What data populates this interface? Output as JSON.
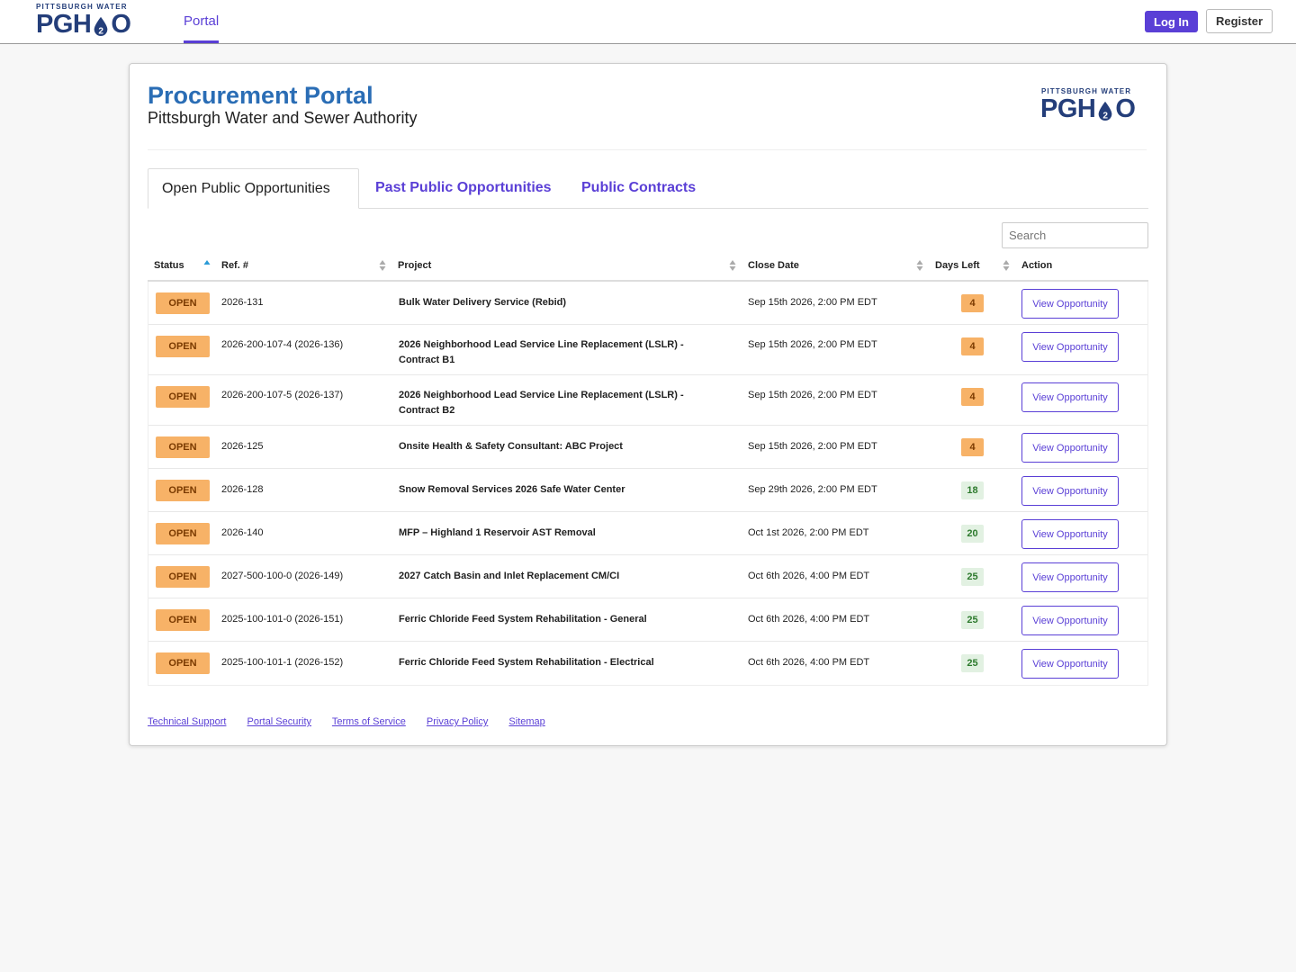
{
  "header": {
    "logo_top": "PITTSBURGH WATER",
    "logo_left": "PGH",
    "logo_sub": "2",
    "logo_right": "O",
    "nav_portal": "Portal",
    "login_label": "Log In",
    "register_label": "Register",
    "accent_color": "#5a3fd6"
  },
  "page": {
    "title": "Procurement Portal",
    "subtitle": "Pittsburgh Water and Sewer Authority"
  },
  "tabs": [
    {
      "label": "Open Public Opportunities",
      "active": true
    },
    {
      "label": "Past Public Opportunities",
      "active": false
    },
    {
      "label": "Public Contracts",
      "active": false
    }
  ],
  "search": {
    "placeholder": "Search"
  },
  "table": {
    "headers": {
      "status": "Status",
      "ref": "Ref. #",
      "project": "Project",
      "close_date": "Close Date",
      "days_left": "Days Left",
      "action": "Action"
    },
    "action_label": "View Opportunity",
    "rows": [
      {
        "status": "OPEN",
        "ref": "2026-131",
        "project": "Bulk Water Delivery Service (Rebid)",
        "close": "Sep 15th 2026, 2:00 PM EDT",
        "days": "4"
      },
      {
        "status": "OPEN",
        "ref": "2026-200-107-4 (2026-136)",
        "project": "2026 Neighborhood Lead Service Line Replacement (LSLR) - Contract B1",
        "close": "Sep 15th 2026, 2:00 PM EDT",
        "days": "4"
      },
      {
        "status": "OPEN",
        "ref": "2026-200-107-5 (2026-137)",
        "project": "2026 Neighborhood Lead Service Line Replacement (LSLR) - Contract B2",
        "close": "Sep 15th 2026, 2:00 PM EDT",
        "days": "4"
      },
      {
        "status": "OPEN",
        "ref": "2026-125",
        "project": "Onsite Health & Safety Consultant: ABC Project",
        "close": "Sep 15th 2026, 2:00 PM EDT",
        "days": "4"
      },
      {
        "status": "OPEN",
        "ref": "2026-128",
        "project": "Snow Removal Services 2026 Safe Water Center",
        "close": "Sep 29th 2026, 2:00 PM EDT",
        "days": "18"
      },
      {
        "status": "OPEN",
        "ref": "2026-140",
        "project": "MFP – Highland 1 Reservoir AST Removal",
        "close": "Oct 1st 2026, 2:00 PM EDT",
        "days": "20"
      },
      {
        "status": "OPEN",
        "ref": "2027-500-100-0 (2026-149)",
        "project": "2027 Catch Basin and Inlet Replacement CM/CI",
        "close": "Oct 6th 2026, 4:00 PM EDT",
        "days": "25"
      },
      {
        "status": "OPEN",
        "ref": "2025-100-101-0 (2026-151)",
        "project": "Ferric Chloride Feed System Rehabilitation - General",
        "close": "Oct 6th 2026, 4:00 PM EDT",
        "days": "25"
      },
      {
        "status": "OPEN",
        "ref": "2025-100-101-1 (2026-152)",
        "project": "Ferric Chloride Feed System Rehabilitation - Electrical",
        "close": "Oct 6th 2026, 4:00 PM EDT",
        "days": "25"
      }
    ]
  },
  "footer": {
    "links": [
      "Technical Support",
      "Portal Security",
      "Terms of Service",
      "Privacy Policy",
      "Sitemap"
    ]
  }
}
